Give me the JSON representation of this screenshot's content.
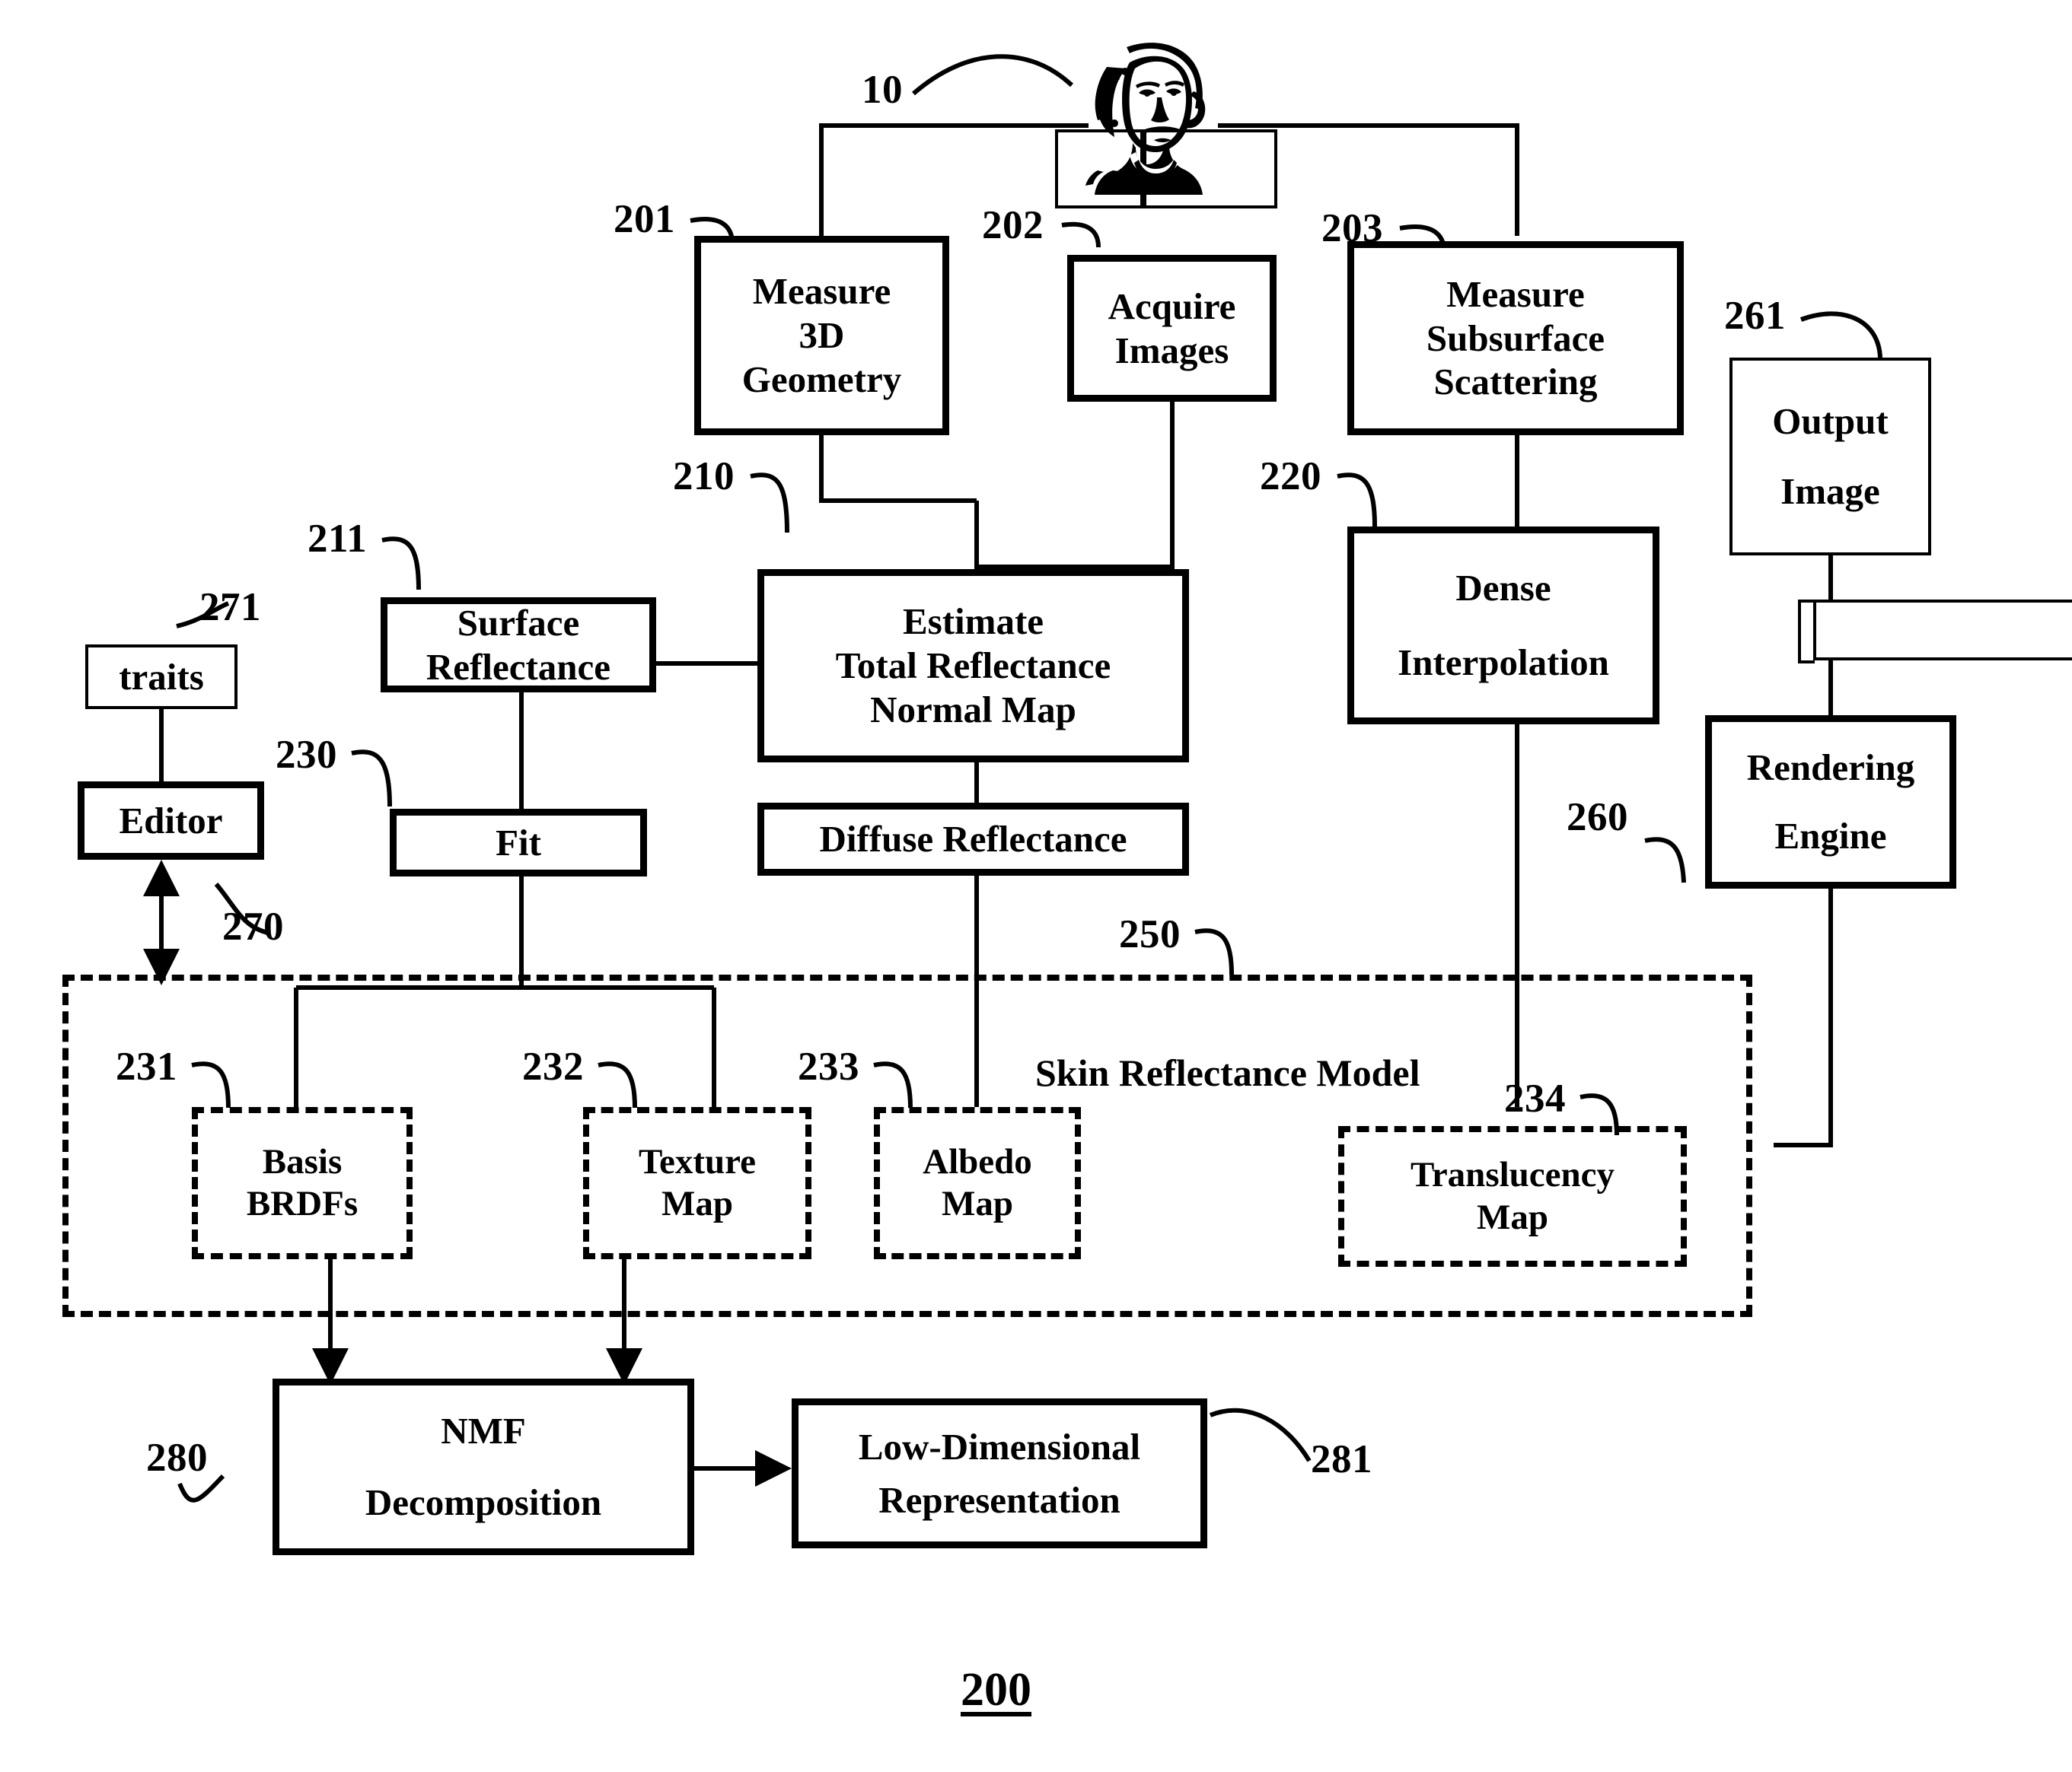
{
  "figure": {
    "number": "200",
    "subject_icon": "bust-portrait-icon",
    "subject_ref": "10"
  },
  "nodes": [
    {
      "id": "measure3d",
      "ref": "201",
      "lines": [
        "Measure",
        "3D",
        "Geometry"
      ]
    },
    {
      "id": "acquire",
      "ref": "202",
      "lines": [
        "Acquire",
        "Images"
      ]
    },
    {
      "id": "subsurface",
      "ref": "203",
      "lines": [
        "Measure",
        "Subsurface",
        "Scattering"
      ]
    },
    {
      "id": "outputimage",
      "ref": "261",
      "lines": [
        "Output",
        "Image"
      ]
    },
    {
      "id": "surfacerefl",
      "ref": "211",
      "lines": [
        "Surface",
        "Reflectance"
      ]
    },
    {
      "id": "estimate",
      "ref": "210",
      "lines": [
        "Estimate",
        "Total Reflectance",
        "Normal Map"
      ]
    },
    {
      "id": "denseinterp",
      "ref": "220",
      "lines": [
        "Dense",
        "Interpolation"
      ]
    },
    {
      "id": "renderengine",
      "ref": "260",
      "lines": [
        "Rendering",
        "Engine"
      ]
    },
    {
      "id": "fit",
      "ref": "230",
      "lines": [
        "Fit"
      ]
    },
    {
      "id": "diffuserefl",
      "ref": "",
      "lines": [
        "Diffuse Reflectance"
      ]
    },
    {
      "id": "traits",
      "ref": "271",
      "lines": [
        "traits"
      ]
    },
    {
      "id": "editor",
      "ref": "270",
      "lines": [
        "Editor"
      ]
    },
    {
      "id": "basisbrdfs",
      "ref": "231",
      "lines": [
        "Basis",
        "BRDFs"
      ]
    },
    {
      "id": "texturemap",
      "ref": "232",
      "lines": [
        "Texture",
        "Map"
      ]
    },
    {
      "id": "albedomap",
      "ref": "233",
      "lines": [
        "Albedo",
        "Map"
      ]
    },
    {
      "id": "translucency",
      "ref": "234",
      "lines": [
        "Translucency",
        "Map"
      ]
    },
    {
      "id": "nmf",
      "ref": "280",
      "lines": [
        "NMF",
        "Decomposition"
      ]
    },
    {
      "id": "lowdim",
      "ref": "281",
      "lines": [
        "Low-Dimensional",
        "Representation"
      ]
    },
    {
      "id": "blankbox",
      "ref": "",
      "lines": [
        ""
      ]
    }
  ],
  "group": {
    "id": "skinmodel",
    "ref": "250",
    "title_line1": "Skin Reflectance",
    "title_line2": "Model"
  },
  "text": {
    "measure3d_l1": "Measure",
    "measure3d_l2": "3D",
    "measure3d_l3": "Geometry",
    "acquire_l1": "Acquire",
    "acquire_l2": "Images",
    "subsurface_l1": "Measure",
    "subsurface_l2": "Subsurface",
    "subsurface_l3": "Scattering",
    "outputimage_l1": "Output",
    "outputimage_l2": "Image",
    "surfacerefl_l1": "Surface",
    "surfacerefl_l2": "Reflectance",
    "estimate_l1": "Estimate",
    "estimate_l2": "Total Reflectance",
    "estimate_l3": "Normal Map",
    "denseinterp_l1": "Dense",
    "denseinterp_l2": "Interpolation",
    "renderengine_l1": "Rendering",
    "renderengine_l2": "Engine",
    "fit_l1": "Fit",
    "diffuserefl_l1": "Diffuse Reflectance",
    "traits_l1": "traits",
    "editor_l1": "Editor",
    "basisbrdfs_l1": "Basis",
    "basisbrdfs_l2": "BRDFs",
    "texturemap_l1": "Texture",
    "texturemap_l2": "Map",
    "albedomap_l1": "Albedo",
    "albedomap_l2": "Map",
    "translucency_l1": "Translucency",
    "translucency_l2": "Map",
    "nmf_l1": "NMF",
    "nmf_l2": "Decomposition",
    "lowdim_l1": "Low-Dimensional",
    "lowdim_l2": "Representation",
    "skin_l1": "Skin Reflectance",
    "skin_l2": "Model"
  },
  "refs": {
    "r10": "10",
    "r201": "201",
    "r202": "202",
    "r203": "203",
    "r210": "210",
    "r211": "211",
    "r220": "220",
    "r230": "230",
    "r231": "231",
    "r232": "232",
    "r233": "233",
    "r234": "234",
    "r250": "250",
    "r260": "260",
    "r261": "261",
    "r270": "270",
    "r271": "271",
    "r280": "280",
    "r281": "281",
    "r200": "200"
  },
  "colors": {
    "ink": "#000000",
    "paper": "#ffffff"
  }
}
